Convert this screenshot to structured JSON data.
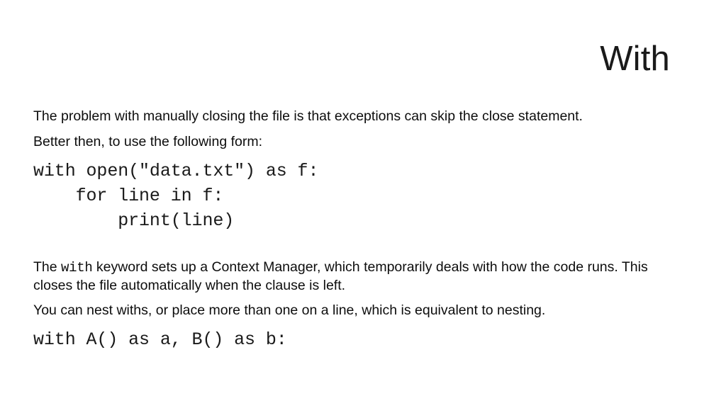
{
  "slide": {
    "title": "With",
    "background_color": "#ffffff",
    "text_color": "#0d0d0d",
    "paragraphs": {
      "p1": "The problem with manually closing the file is that exceptions can skip the close statement.",
      "p2": "Better then, to use the following form:",
      "p3_prefix": "The ",
      "p3_mono": "with",
      "p3_suffix": " keyword sets up a Context Manager, which temporarily deals with how the code runs. This closes the file automatically when the clause is left.",
      "p4": "You can nest withs, or place more than one on a line, which is equivalent to nesting."
    },
    "code_block_1": [
      "with open(\"data.txt\") as f:",
      "    for line in f:",
      "        print(line)"
    ],
    "code_block_2": [
      "with A() as a, B() as b:"
    ]
  }
}
